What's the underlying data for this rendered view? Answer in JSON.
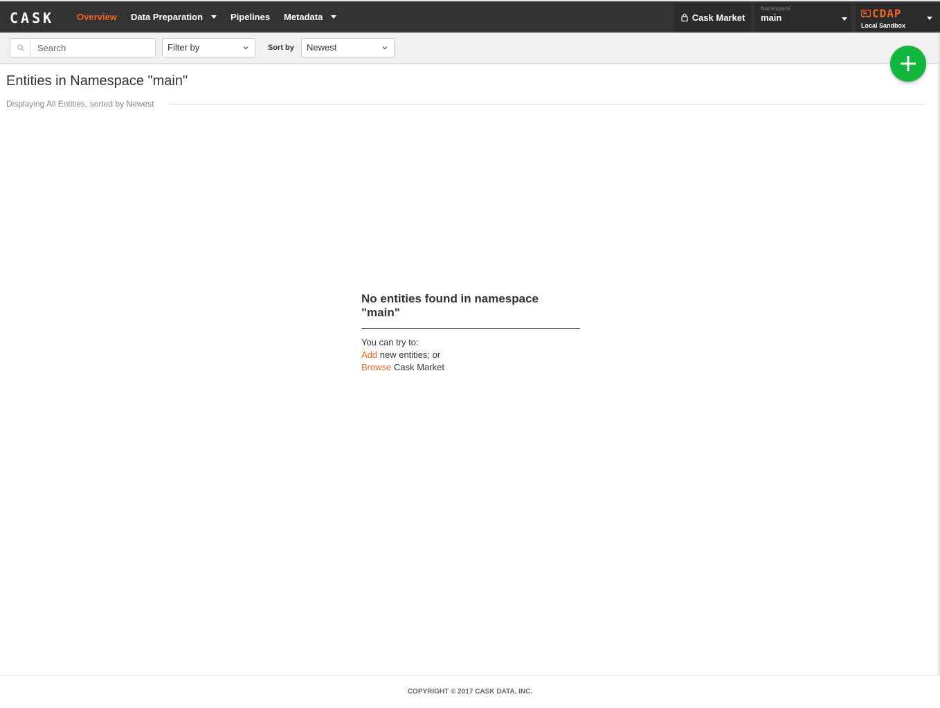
{
  "navbar": {
    "logo": "CASK",
    "items": [
      {
        "label": "Overview",
        "active": true
      },
      {
        "label": "Data Preparation"
      },
      {
        "label": "Pipelines"
      },
      {
        "label": "Metadata"
      }
    ],
    "market_label": "Cask Market",
    "namespace_label": "Namespace",
    "namespace_value": "main",
    "cdap_logo": "CDAP",
    "cdap_subtitle": "Local Sandbox"
  },
  "toolbar": {
    "search_placeholder": "Search",
    "filter_label": "Filter by",
    "sort_label": "Sort by",
    "sort_value": "Newest"
  },
  "content": {
    "title": "Entities in Namespace \"main\"",
    "subtitle": "Displaying All Entities, sorted by Newest"
  },
  "empty_state": {
    "title": "No entities found in namespace \"main\"",
    "intro": "You can try to:",
    "add_link": "Add",
    "add_rest": " new entities; or",
    "browse_link": "Browse",
    "browse_rest": " Cask Market"
  },
  "footer": {
    "copyright": "COPYRIGHT © 2017 CASK DATA, INC."
  },
  "colors": {
    "accent": "#f26522",
    "navbar_bg": "#333333",
    "add_button": "#11b63e"
  },
  "icons": {
    "search": "search-icon",
    "lock": "lock-icon",
    "add": "plus-icon",
    "caret": "caret-down-icon"
  }
}
